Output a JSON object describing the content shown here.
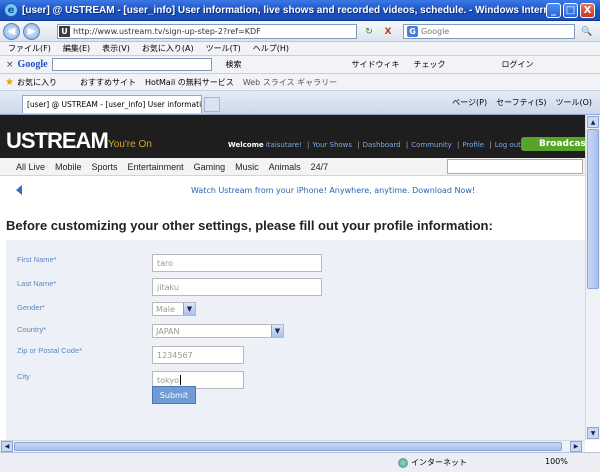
{
  "window": {
    "icon_letter": "e",
    "title": "[user] @ USTREAM - [user_info] User information, live shows and recorded videos, schedule. - Windows Internet Explorer",
    "controls": {
      "minimize": "_",
      "maximize": "□",
      "close": "X"
    }
  },
  "address_bar": {
    "back": "◀",
    "forward": "▶",
    "site_badge": "U",
    "url": "http://www.ustream.tv/sign-up-step-2?ref=KDF",
    "refresh": "↻",
    "stop": "X",
    "search_placeholder": "Google",
    "search_engine_badge": "G",
    "search_button": "🔍"
  },
  "menu": [
    "ファイル(F)",
    "編集(E)",
    "表示(V)",
    "お気に入り(A)",
    "ツール(T)",
    "ヘルプ(H)"
  ],
  "google_toolbar": {
    "close": "×",
    "logo": "Google",
    "items": [
      "検索",
      "サイドウィキ",
      "チェック",
      "ログイン"
    ]
  },
  "favorites_bar": {
    "favorites_label": "お気に入り",
    "items": [
      "おすすめサイト",
      "HotMail の無料サービス",
      "Web スライス ギャラリー"
    ]
  },
  "tabs": {
    "active_tab": "[user] @ USTREAM - [user_info] User information, l...",
    "commands": [
      "ページ(P)",
      "セーフティ(S)",
      "ツール(O)"
    ]
  },
  "site": {
    "logo": "USTREAM",
    "tagline": "You're On",
    "welcome": "Welcome",
    "username": "itaisutare!",
    "links": [
      "Your Shows",
      "Dashboard",
      "Community",
      "Profile",
      "Log out"
    ],
    "broadcast_button": "Broadcast",
    "categories": [
      "All Live",
      "Mobile",
      "Sports",
      "Entertainment",
      "Gaming",
      "Music",
      "Animals",
      "24/7"
    ],
    "promo_text": "Watch Ustream from your iPhone! Anywhere, anytime. Download Now!",
    "heading": "Before customizing your other settings, please fill out your profile information:",
    "form": {
      "first_name_label": "First Name*",
      "first_name_value": "taro",
      "last_name_label": "Last Name*",
      "last_name_value": "jitaku",
      "gender_label": "Gender*",
      "gender_value": "Male",
      "country_label": "Country*",
      "country_value": "JAPAN",
      "zip_label": "Zip or Postal Code*",
      "zip_value": "1234567",
      "city_label": "City",
      "city_value": "tokyo",
      "submit_label": "Submit"
    }
  },
  "status_bar": {
    "zone": "インターネット",
    "zoom": "100%"
  },
  "colors": {
    "titlebar": "#1a4fc2",
    "brand_bar": "#1e1e1e",
    "broadcast": "#58a32a",
    "link_blue": "#2a62b5",
    "tagline": "#d7a928",
    "form_panel": "#edf1f7",
    "submit": "#6f9cd4"
  }
}
